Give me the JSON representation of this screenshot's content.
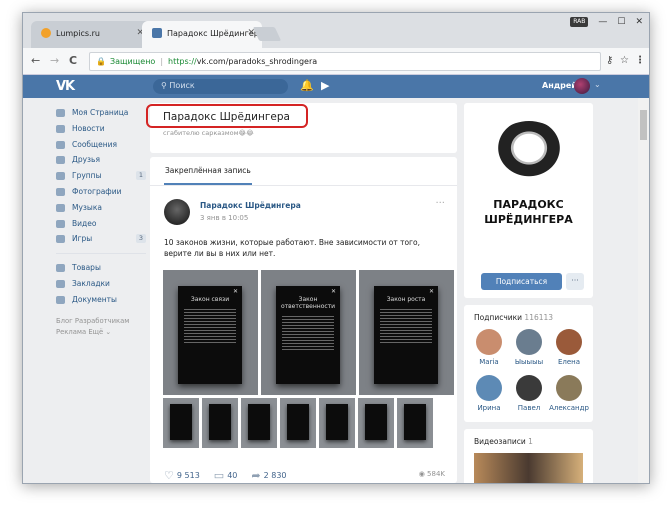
{
  "browser": {
    "tabs": [
      {
        "title": "Lumpics.ru",
        "active": false,
        "favicon_color": "#f2a12a"
      },
      {
        "title": "Парадокс Шрёдингера",
        "active": true,
        "favicon_color": "#4a76a8"
      }
    ],
    "badge": "RAB",
    "back_glyph": "←",
    "forward_glyph": "→",
    "reload_glyph": "C",
    "secure_label": "Защищено",
    "url_protocol": "https://",
    "url_path": "vk.com/paradoks_shrodingera",
    "bookmark_glyph": "☆",
    "menu_glyph": "⋮"
  },
  "vk": {
    "logo": "VK",
    "search_placeholder": "Поиск",
    "user_name": "Андрей"
  },
  "sidebar": {
    "items": [
      {
        "label": "Моя Страница",
        "count": ""
      },
      {
        "label": "Новости",
        "count": ""
      },
      {
        "label": "Сообщения",
        "count": ""
      },
      {
        "label": "Друзья",
        "count": ""
      },
      {
        "label": "Группы",
        "count": "1"
      },
      {
        "label": "Фотографии",
        "count": ""
      },
      {
        "label": "Музыка",
        "count": ""
      },
      {
        "label": "Видео",
        "count": ""
      },
      {
        "label": "Игры",
        "count": "3"
      }
    ],
    "items2": [
      {
        "label": "Товары"
      },
      {
        "label": "Закладки"
      },
      {
        "label": "Документы"
      }
    ],
    "footer1": "Блог  Разработчикам",
    "footer2": "Реклама  Ещё ⌄"
  },
  "page": {
    "name": "Парадокс Шрёдингера",
    "status": "сгабителю сарказмом😂😂"
  },
  "post": {
    "tab": "Закреплённая запись",
    "author": "Парадокс Шрёдингера",
    "date": "3 янв в 10:05",
    "text": "10 законов жизни, которые работают. Вне зависимости от того, верите ли вы в них или нет.",
    "cards": [
      "Закон связи",
      "Закон ответственности",
      "Закон роста"
    ],
    "likes": "9 513",
    "comments": "40",
    "shares": "2 830",
    "views": "584K"
  },
  "community": {
    "avatar_line1": "ПАРАДОКС",
    "avatar_line2": "ШРЁДИНГЕРА",
    "subscribe": "Подписаться",
    "more": "···",
    "subscribers_label": "Подписчики",
    "subscribers_count": "116113",
    "subscribers": [
      {
        "name": "Maria",
        "color": "#c98d6e"
      },
      {
        "name": "Ыыыыы",
        "color": "#6a7d8f"
      },
      {
        "name": "Елена",
        "color": "#9a5a3a"
      },
      {
        "name": "Ирина",
        "color": "#5d8ab5"
      },
      {
        "name": "Павел",
        "color": "#3a3a3a"
      },
      {
        "name": "Александр",
        "color": "#8a7a5a"
      }
    ],
    "videos_label": "Видеозаписи",
    "videos_count": "1"
  }
}
